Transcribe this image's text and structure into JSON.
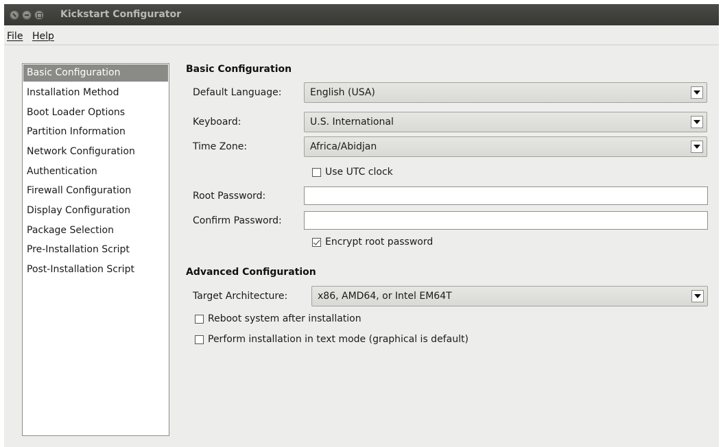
{
  "window": {
    "title": "Kickstart Configurator"
  },
  "menu": {
    "file": "File",
    "help": "Help"
  },
  "nav": {
    "selected_index": 0,
    "items": [
      "Basic Configuration",
      "Installation Method",
      "Boot Loader Options",
      "Partition Information",
      "Network Configuration",
      "Authentication",
      "Firewall Configuration",
      "Display Configuration",
      "Package Selection",
      "Pre-Installation Script",
      "Post-Installation Script"
    ]
  },
  "basic": {
    "title": "Basic Configuration",
    "default_language": {
      "label": "Default Language:",
      "value": "English (USA)"
    },
    "keyboard": {
      "label": "Keyboard:",
      "value": "U.S. International"
    },
    "time_zone": {
      "label": "Time Zone:",
      "value": "Africa/Abidjan"
    },
    "utc_clock": {
      "label": "Use UTC clock",
      "checked": false
    },
    "root_password": {
      "label": "Root Password:",
      "value": ""
    },
    "confirm_password": {
      "label": "Confirm Password:",
      "value": ""
    },
    "encrypt_password": {
      "label": "Encrypt root password",
      "checked": true
    }
  },
  "advanced": {
    "title": "Advanced Configuration",
    "target_architecture": {
      "label": "Target Architecture:",
      "value": "x86, AMD64, or Intel EM64T"
    },
    "reboot": {
      "label": "Reboot system after installation",
      "checked": false
    },
    "text_mode": {
      "label": "Perform installation in text mode (graphical is default)",
      "checked": false
    }
  },
  "colors": {
    "selection": "#8a8a86",
    "titlebar": "#3c3c39",
    "window_bg": "#ededeb"
  }
}
